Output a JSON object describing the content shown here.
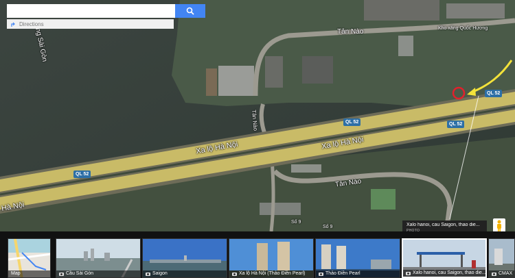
{
  "search": {
    "placeholder": "",
    "directions_label": "Directions"
  },
  "map_labels": {
    "river_name": "ng Sài Gòn",
    "street_tan_nao_top": "Tân Nào",
    "street_tan_nao_bottom": "Tân Nào",
    "highway_name_1": "Xa lộ Hà Nội",
    "highway_name_2": "Xa lộ Hà Nội",
    "highway_name_left": "Hà Nội",
    "street_vertical": "Tân Nào",
    "station": "Kho xăng Quốc Hương",
    "street_so9": "Số 9",
    "street_so9_b": "Số 9",
    "shield_text": "QL 52"
  },
  "tooltip": {
    "title": "Xalo hanoi, cau Saigon, thao die...",
    "kind": "PHOTO"
  },
  "photos": [
    {
      "label": "Map"
    },
    {
      "label": "Cầu Sài Gòn"
    },
    {
      "label": "Saigon"
    },
    {
      "label": "Xa lộ Hà Nội (Thảo Điền Pearl)"
    },
    {
      "label": "Thảo Điền Pearl"
    },
    {
      "label": "Xalo hanoi, cau Saigon, thao die..."
    },
    {
      "label": "CMAX"
    }
  ],
  "colors": {
    "accent": "#4285f4",
    "marker": "#e3202c",
    "arrow": "#f3e23a",
    "road": "#d9c96a"
  }
}
